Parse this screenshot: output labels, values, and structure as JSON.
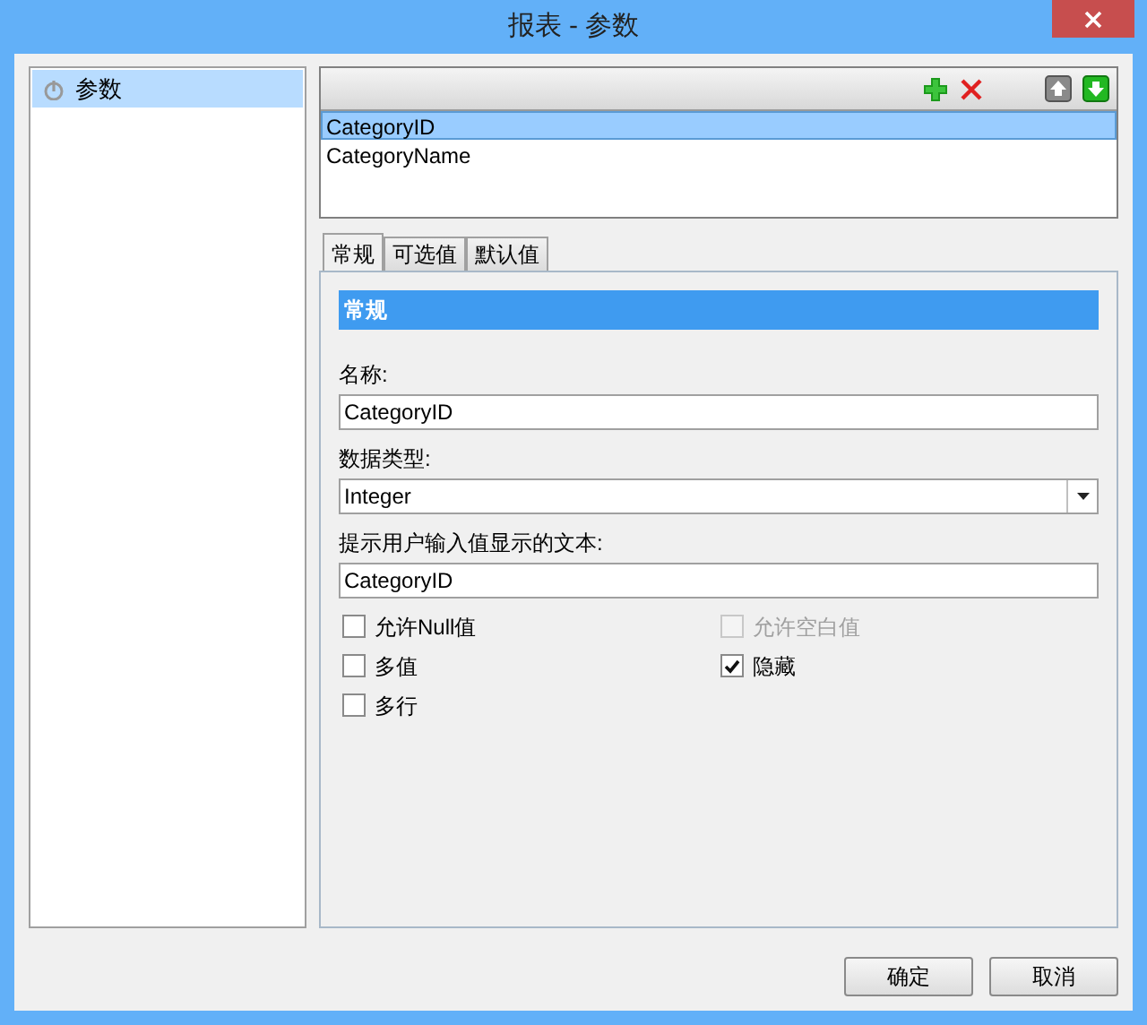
{
  "window": {
    "title": "报表 - 参数"
  },
  "tree": [
    {
      "label": "参数",
      "selected": true
    }
  ],
  "parameters": [
    {
      "label": "CategoryID",
      "selected": true
    },
    {
      "label": "CategoryName",
      "selected": false
    }
  ],
  "tabs": [
    {
      "label": "常规",
      "selected": true
    },
    {
      "label": "可选值",
      "selected": false
    },
    {
      "label": "默认值",
      "selected": false
    }
  ],
  "section": {
    "title": "常规"
  },
  "fields": [
    {
      "label": "名称:",
      "value": "CategoryID",
      "kind": "text"
    },
    {
      "label": "数据类型:",
      "value": "Integer",
      "kind": "dropdown"
    },
    {
      "label": "提示用户输入值显示的文本:",
      "value": "CategoryID",
      "kind": "text"
    }
  ],
  "checkboxes": [
    {
      "label": "允许Null值",
      "checked": false,
      "disabled": false
    },
    {
      "label": "允许空白值",
      "checked": false,
      "disabled": true
    },
    {
      "label": "多值",
      "checked": false,
      "disabled": false
    },
    {
      "label": "隐藏",
      "checked": true,
      "disabled": false
    },
    {
      "label": "多行",
      "checked": false,
      "disabled": false
    }
  ],
  "buttons": [
    "确定",
    "取消"
  ]
}
